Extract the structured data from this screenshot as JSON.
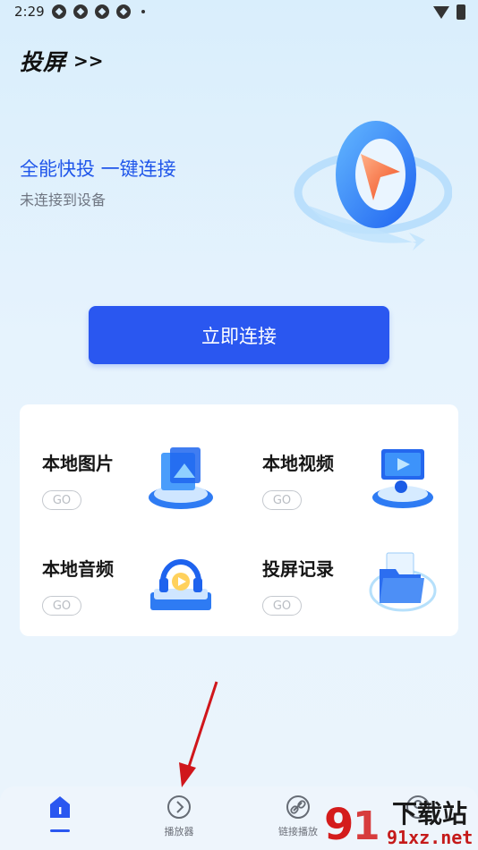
{
  "status_bar": {
    "time": "2:29"
  },
  "brand": {
    "name": "投屏",
    "chevrons": ">>"
  },
  "hero": {
    "title": "全能快投 一键连接",
    "subtitle": "未连接到设备"
  },
  "connect_button": {
    "label": "立即连接"
  },
  "tiles": [
    {
      "label": "本地图片",
      "go": "GO"
    },
    {
      "label": "本地视频",
      "go": "GO"
    },
    {
      "label": "本地音频",
      "go": "GO"
    },
    {
      "label": "投屏记录",
      "go": "GO"
    }
  ],
  "bottom_nav": [
    {
      "label": "",
      "icon": "home-icon",
      "active": true
    },
    {
      "label": "播放器",
      "icon": "play-circle-icon"
    },
    {
      "label": "链接播放",
      "icon": "link-icon"
    },
    {
      "label": "",
      "icon": "profile-icon"
    }
  ],
  "watermark": {
    "line1": "下载站",
    "line2": "91xz.net"
  },
  "colors": {
    "accent": "#2a57f0",
    "title_blue": "#1f55ea",
    "annotation_red": "#d0161b"
  }
}
